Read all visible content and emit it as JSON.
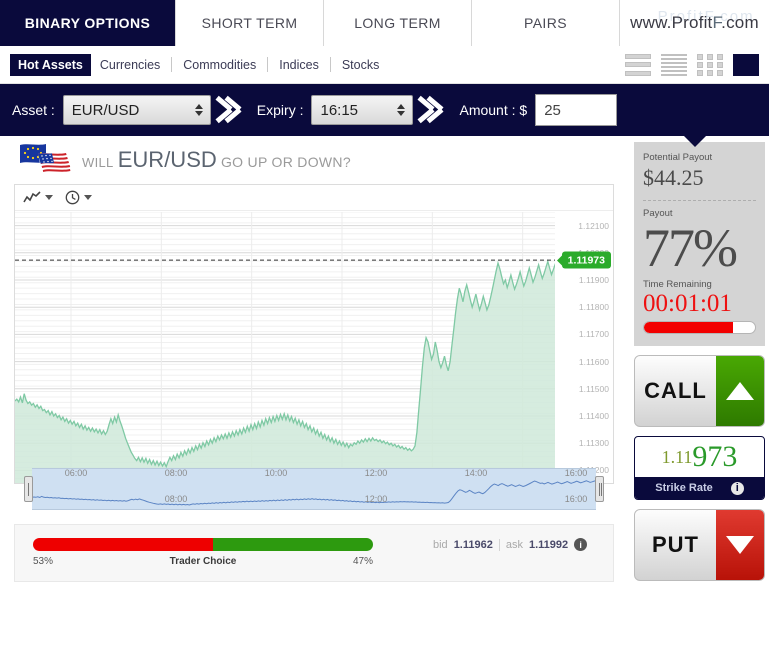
{
  "topnav": {
    "tabs": [
      {
        "label": "BINARY OPTIONS",
        "active": true
      },
      {
        "label": "SHORT TERM",
        "active": false
      },
      {
        "label": "LONG TERM",
        "active": false
      },
      {
        "label": "PAIRS",
        "active": false
      }
    ],
    "brand_prefix": "www.Profit",
    "brand_f": "F",
    "brand_suffix": ".com",
    "watermark": "ProfitF.com"
  },
  "categories": {
    "items": [
      {
        "label": "Hot Assets",
        "active": true
      },
      {
        "label": "Currencies",
        "active": false
      },
      {
        "label": "Commodities",
        "active": false
      },
      {
        "label": "Indices",
        "active": false
      },
      {
        "label": "Stocks",
        "active": false
      }
    ],
    "view_icons": [
      "list-large-icon",
      "list-compact-icon",
      "grid-icon",
      "solid-view-icon"
    ]
  },
  "trade_bar": {
    "asset_label": "Asset :",
    "asset_value": "EUR/USD",
    "expiry_label": "Expiry :",
    "expiry_value": "16:15",
    "amount_label": "Amount : $",
    "amount_value": "25"
  },
  "chart_header": {
    "will": "WILL",
    "pair": "EUR/USD",
    "tail": "GO UP OR DOWN?",
    "flag": "eur-usd-flag-icon"
  },
  "chart_tools": {
    "series_type_icon": "line-chart-icon",
    "interval_icon": "clock-icon"
  },
  "right_panel": {
    "potential_payout_label": "Potential Payout",
    "potential_payout_value": "$44.25",
    "payout_label": "Payout",
    "payout_value": "77%",
    "time_label": "Time Remaining",
    "time_value": "00:01:01",
    "time_progress_percent": 80,
    "call_label": "CALL",
    "put_label": "PUT",
    "strike_prefix": "1.11",
    "strike_suffix": "973",
    "strike_label": "Strike Rate",
    "info_glyph": "i"
  },
  "sentiment": {
    "left_percent": "53%",
    "right_percent": "47%",
    "title": "Trader Choice",
    "left_value": 53,
    "right_value": 47,
    "bid_label": "bid",
    "bid_value": "1.11962",
    "ask_label": "ask",
    "ask_value": "1.11992",
    "info_glyph": "i"
  },
  "colors": {
    "navy": "#0a0a3c",
    "call_green": "#3c9400",
    "put_red": "#cc1710",
    "price_green": "#2bab2b",
    "timer_red": "#f20000",
    "sent_red": "#ee0000",
    "sent_green": "#2d9a0f"
  },
  "chart_data": {
    "type": "area",
    "title": "EUR/USD",
    "xlabel": "",
    "ylabel": "",
    "ylim": [
      1.1115,
      1.1215
    ],
    "yticks": [
      "1.12100",
      "1.12000",
      "1.11900",
      "1.11800",
      "1.11700",
      "1.11600",
      "1.11500",
      "1.11400",
      "1.11300",
      "1.11200"
    ],
    "ytick_values": [
      1.121,
      1.12,
      1.119,
      1.118,
      1.117,
      1.116,
      1.115,
      1.114,
      1.113,
      1.112
    ],
    "xticks": [
      "06:00",
      "08:00",
      "10:00",
      "12:00",
      "14:00",
      "16:00"
    ],
    "current_price": "1.11973",
    "current_price_value": 1.11973,
    "threshold_line": 1.11973,
    "grid": true,
    "legend": "none",
    "series": [
      {
        "name": "EUR/USD",
        "line_color": "#7fc9a4",
        "fill_color": "#cfe9d9",
        "values": [
          1.11455,
          1.11462,
          1.11452,
          1.1147,
          1.11448,
          1.11482,
          1.11458,
          1.11446,
          1.11452,
          1.1144,
          1.11446,
          1.11432,
          1.11441,
          1.11428,
          1.11436,
          1.1142,
          1.11424,
          1.11412,
          1.1142,
          1.11404,
          1.11416,
          1.114,
          1.11408,
          1.11394,
          1.11402,
          1.11386,
          1.11396,
          1.1138,
          1.1139,
          1.11374,
          1.11384,
          1.1137,
          1.1138,
          1.11364,
          1.11374,
          1.11358,
          1.1137,
          1.11352,
          1.11364,
          1.11348,
          1.11358,
          1.11344,
          1.11356,
          1.11342,
          1.11352,
          1.11338,
          1.1135,
          1.11334,
          1.11346,
          1.11332,
          1.11344,
          1.11368,
          1.1139,
          1.11372,
          1.11396,
          1.11378,
          1.11404,
          1.1138,
          1.11362,
          1.1134,
          1.11318,
          1.113,
          1.11284,
          1.11268,
          1.11256,
          1.11244,
          1.11236,
          1.11248,
          1.11232,
          1.11246,
          1.1123,
          1.11244,
          1.11226,
          1.1124,
          1.11222,
          1.11236,
          1.1122,
          1.11234,
          1.11218,
          1.1123,
          1.11216,
          1.11228,
          1.11214,
          1.11232,
          1.11248,
          1.11236,
          1.11254,
          1.1124,
          1.1126,
          1.11246,
          1.11266,
          1.11252,
          1.11272,
          1.11258,
          1.11278,
          1.11264,
          1.11284,
          1.1127,
          1.1129,
          1.11276,
          1.11296,
          1.11282,
          1.11302,
          1.11288,
          1.11308,
          1.11294,
          1.11314,
          1.113,
          1.1132,
          1.11306,
          1.11326,
          1.11312,
          1.1133,
          1.11316,
          1.11334,
          1.11318,
          1.11338,
          1.11322,
          1.11342,
          1.11326,
          1.11346,
          1.1133,
          1.1135,
          1.11334,
          1.11356,
          1.1134,
          1.11362,
          1.11344,
          1.11368,
          1.1135,
          1.11372,
          1.11354,
          1.11378,
          1.1136,
          1.11384,
          1.11366,
          1.1139,
          1.11372,
          1.11394,
          1.11376,
          1.11398,
          1.1138,
          1.11402,
          1.11384,
          1.11406,
          1.11388,
          1.11408,
          1.11386,
          1.11404,
          1.11382,
          1.11398,
          1.11376,
          1.11392,
          1.1137,
          1.11386,
          1.11364,
          1.1138,
          1.11358,
          1.11372,
          1.1135,
          1.11364,
          1.11342,
          1.11356,
          1.11334,
          1.11348,
          1.11326,
          1.1134,
          1.11318,
          1.11332,
          1.11312,
          1.11326,
          1.11306,
          1.1132,
          1.113,
          1.11314,
          1.11296,
          1.11308,
          1.11292,
          1.11304,
          1.11288,
          1.113,
          1.11284,
          1.11296,
          1.1129,
          1.11302,
          1.11296,
          1.11308,
          1.113,
          1.11312,
          1.11304,
          1.11316,
          1.11306,
          1.11318,
          1.11308,
          1.1132,
          1.1131,
          1.11314,
          1.11306,
          1.11312,
          1.11302,
          1.11308,
          1.11298,
          1.11304,
          1.11294,
          1.113,
          1.1129,
          1.11296,
          1.11286,
          1.11292,
          1.11282,
          1.11288,
          1.11278,
          1.11284,
          1.11274,
          1.1128,
          1.11272,
          1.11278,
          1.1129,
          1.1134,
          1.1142,
          1.115,
          1.1158,
          1.1165,
          1.11688,
          1.11672,
          1.1164,
          1.11608,
          1.11628,
          1.11672,
          1.1164,
          1.116,
          1.11578,
          1.11596,
          1.1162,
          1.11588,
          1.11566,
          1.116,
          1.1166,
          1.1172,
          1.1178,
          1.1183,
          1.1187,
          1.11848,
          1.1182,
          1.11858,
          1.11882,
          1.11856,
          1.11826,
          1.118,
          1.11822,
          1.11848,
          1.11818,
          1.1179,
          1.11812,
          1.1184,
          1.11816,
          1.1179,
          1.11808,
          1.11836,
          1.11868,
          1.119,
          1.11934,
          1.11962,
          1.1194,
          1.11912,
          1.11886,
          1.119,
          1.11872,
          1.11894,
          1.11918,
          1.1189,
          1.11866,
          1.11884,
          1.11906,
          1.1193,
          1.11902,
          1.11878,
          1.11896,
          1.1192,
          1.11944,
          1.11918,
          1.11892,
          1.1191,
          1.11932,
          1.11956,
          1.1193,
          1.11906,
          1.11924,
          1.11946,
          1.11968,
          1.11944,
          1.1192,
          1.11938,
          1.11958,
          1.11973
        ]
      }
    ],
    "navigator": {
      "xticks": [
        "06:00",
        "08:00",
        "10:00",
        "12:00",
        "14:00",
        "16:00"
      ],
      "inside_labels": [
        "08:00",
        "12:00",
        "16:00"
      ],
      "line_color": "#5b84c4",
      "bg_color": "#cfe0f2"
    }
  }
}
